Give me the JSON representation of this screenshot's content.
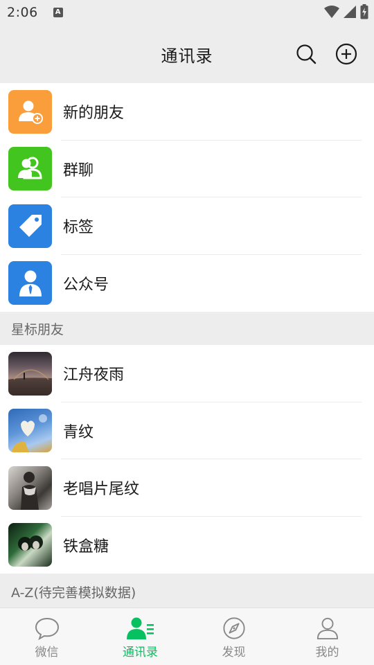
{
  "status_bar": {
    "time": "2:06",
    "notification_glyph": "A"
  },
  "header": {
    "title": "通讯录"
  },
  "fixed_entries": [
    {
      "label": "新的朋友",
      "icon": "add-friend-icon",
      "color": "#fa9d3b"
    },
    {
      "label": "群聊",
      "icon": "group-chat-icon",
      "color": "#43c51f"
    },
    {
      "label": "标签",
      "icon": "tag-icon",
      "color": "#2c82e0"
    },
    {
      "label": "公众号",
      "icon": "official-account-icon",
      "color": "#2c82e0"
    }
  ],
  "starred_section": {
    "title": "星标朋友"
  },
  "starred_friends": [
    {
      "name": "江舟夜雨"
    },
    {
      "name": "青纹"
    },
    {
      "name": "老唱片尾纹"
    },
    {
      "name": "铁盒糖"
    }
  ],
  "az_section": {
    "title": "A-Z(待完善模拟数据)"
  },
  "bottom_nav": [
    {
      "label": "微信",
      "icon": "chat-bubble-icon",
      "active": false
    },
    {
      "label": "通讯录",
      "icon": "contacts-icon",
      "active": true
    },
    {
      "label": "发现",
      "icon": "compass-icon",
      "active": false
    },
    {
      "label": "我的",
      "icon": "person-icon",
      "active": false
    }
  ],
  "colors": {
    "accent": "#07c160",
    "inactive": "#888888",
    "background": "#ededed"
  }
}
